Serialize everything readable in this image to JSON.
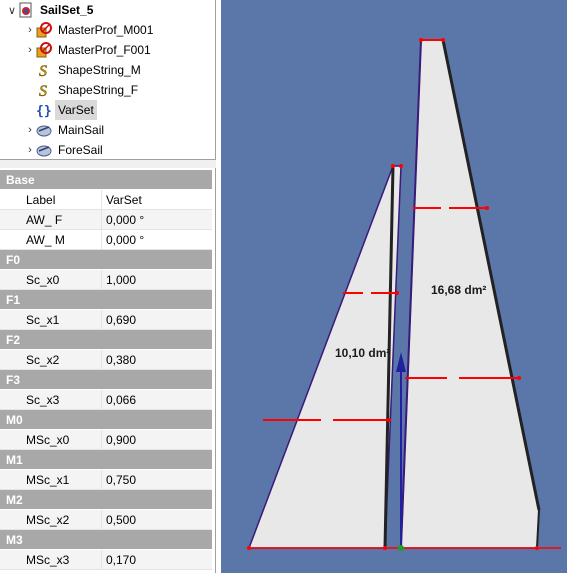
{
  "tree": {
    "root": {
      "label": "SailSet_5",
      "icon": "sailset-document-icon"
    },
    "items": [
      {
        "label": "MasterProf_M001",
        "icon": "profile-object-icon",
        "expandable": true
      },
      {
        "label": "MasterProf_F001",
        "icon": "profile-object-icon",
        "expandable": true
      },
      {
        "label": "ShapeString_M",
        "icon": "shapestring-icon",
        "expandable": false
      },
      {
        "label": "ShapeString_F",
        "icon": "shapestring-icon",
        "expandable": false
      },
      {
        "label": "VarSet",
        "icon": "varset-icon",
        "expandable": false,
        "selected": true
      },
      {
        "label": "MainSail",
        "icon": "sail-object-icon",
        "expandable": true
      },
      {
        "label": "ForeSail",
        "icon": "sail-object-icon",
        "expandable": true
      }
    ]
  },
  "properties": {
    "group_base": "Base",
    "header": {
      "label": "Label",
      "value": "VarSet"
    },
    "base_rows": [
      {
        "key": "AW_ F",
        "value": "0,000 °"
      },
      {
        "key": "AW_ M",
        "value": "0,000 °"
      }
    ],
    "groups": [
      {
        "name": "F0",
        "key": "Sc_x0",
        "value": "1,000"
      },
      {
        "name": "F1",
        "key": "Sc_x1",
        "value": "0,690"
      },
      {
        "name": "F2",
        "key": "Sc_x2",
        "value": "0,380"
      },
      {
        "name": "F3",
        "key": "Sc_x3",
        "value": "0,066"
      },
      {
        "name": "M0",
        "key": "MSc_x0",
        "value": "0,900"
      },
      {
        "name": "M1",
        "key": "MSc_x1",
        "value": "0,750"
      },
      {
        "name": "M2",
        "key": "MSc_x2",
        "value": "0,500"
      },
      {
        "name": "M3",
        "key": "MSc_x3",
        "value": "0,170"
      }
    ]
  },
  "view3d": {
    "background": "#5b76a8",
    "foresail_area": "10,10 dm²",
    "mainsail_area": "16,68 dm²",
    "sail_fill": "#e8e8e8",
    "edge_color": "#3a1a7a",
    "marker_color": "#ff0000"
  }
}
